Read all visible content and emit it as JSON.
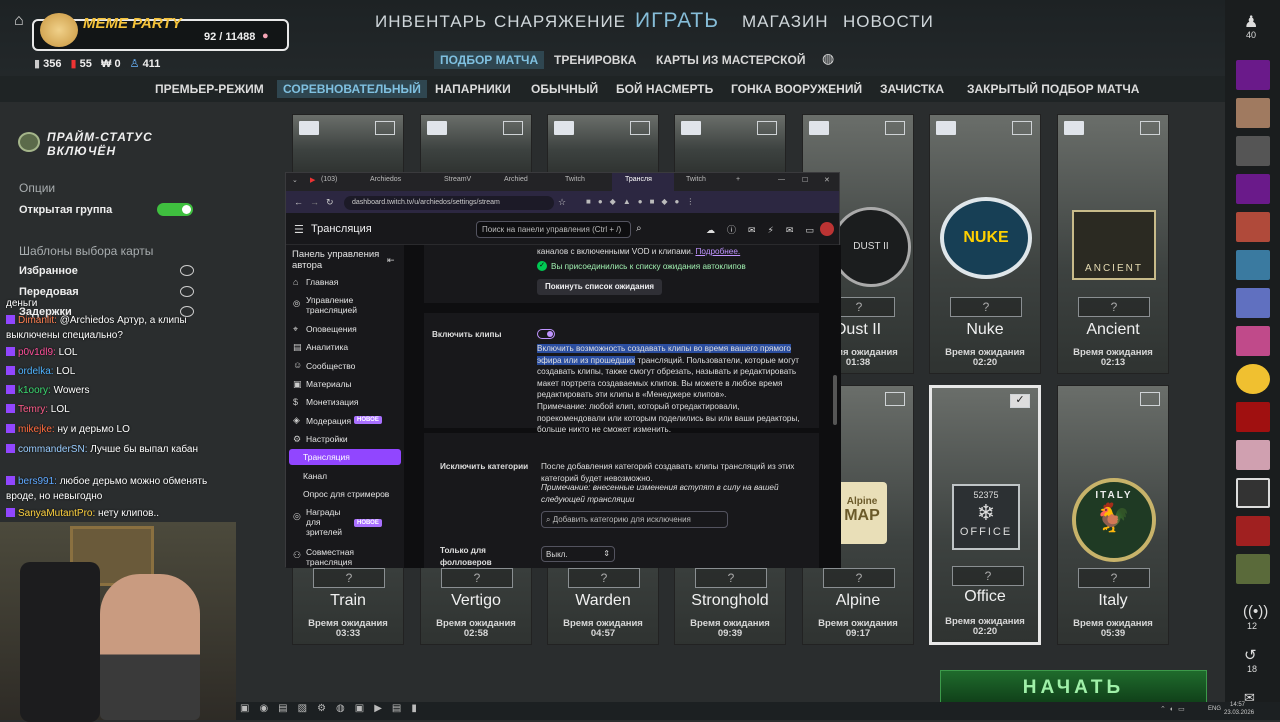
{
  "colors": {
    "accent": "#7fc0e0",
    "twitch": "#9146ff",
    "green": "#2ea043",
    "new_badge": "#a970ff"
  },
  "header": {
    "party_name": "MEME PARTY",
    "xp": "92 / 11488",
    "stats": [
      {
        "icon": "coin-icon",
        "value": "356"
      },
      {
        "icon": "medal-icon",
        "value": "55"
      },
      {
        "icon": "key-icon",
        "value": "0"
      },
      {
        "icon": "people-icon",
        "value": "411"
      }
    ],
    "nav": [
      "ИНВЕНТАРЬ",
      "СНАРЯЖЕНИЕ",
      "ИГРАТЬ",
      "МАГАЗИН",
      "НОВОСТИ"
    ],
    "subnav": [
      "ПОДБОР МАТЧА",
      "ТРЕНИРОВКА",
      "КАРТЫ ИЗ МАСТЕРСКОЙ"
    ],
    "modes": [
      "ПРЕМЬЕР-РЕЖИМ",
      "СОРЕВНОВАТЕЛЬНЫЙ",
      "НАПАРНИКИ",
      "ОБЫЧНЫЙ",
      "БОЙ НАСМЕРТЬ",
      "ГОНКА ВООРУЖЕНИЙ",
      "ЗАЧИСТКА",
      "ЗАКРЫТЫЙ ПОДБОР МАТЧА"
    ]
  },
  "left": {
    "prime_line1": "ПРАЙМ-СТАТУС",
    "prime_line2": "ВКЛЮЧЁН",
    "options": "Опции",
    "open_group": "Открытая группа",
    "templates": "Шаблоны выбора карты",
    "t1": "Избранное",
    "t2": "Передовая",
    "t3": "Задержки"
  },
  "maps_top": [
    {
      "name": "Dust II",
      "label": "Время ожидания",
      "time": "01:38"
    },
    {
      "name": "Nuke",
      "label": "Время ожидания",
      "time": "02:20"
    },
    {
      "name": "Ancient",
      "label": "Время ожидания",
      "time": "02:13"
    }
  ],
  "emblems": {
    "dust": "DUST II",
    "nuke": "NUKE",
    "ancient": "ANCIENT",
    "alpine": "Alpine",
    "alpine2": "MAP",
    "office": "52375",
    "office2": "OFFICE",
    "italy": "ITALY"
  },
  "maps_bottom": [
    {
      "name": "Train",
      "label": "Время ожидания",
      "time": "03:33"
    },
    {
      "name": "Vertigo",
      "label": "Время ожидания",
      "time": "02:58"
    },
    {
      "name": "Warden",
      "label": "Время ожидания",
      "time": "04:57"
    },
    {
      "name": "Stronghold",
      "label": "Время ожидания",
      "time": "09:39"
    },
    {
      "name": "Alpine",
      "label": "Время ожидания",
      "time": "09:17"
    },
    {
      "name": "Office",
      "label": "Время ожидания",
      "time": "02:20"
    },
    {
      "name": "Italy",
      "label": "Время ожидания",
      "time": "05:39"
    }
  ],
  "q": "?",
  "start": "НАЧАТЬ",
  "rightbar": {
    "friends": "40",
    "live": "12",
    "recent": "18"
  },
  "browser": {
    "tabs": [
      "(103)",
      "Archiedos",
      "StreamV",
      "Archied",
      "Twitch",
      "Трансля",
      "Twitch"
    ],
    "url": "dashboard.twitch.tv/u/archiedos/settings/stream",
    "app_title": "Трансляция",
    "search": "Поиск на панели управления (Ctrl + /)",
    "sidebar_title": "Панель управления автора",
    "sidebar": [
      "Главная",
      "Управление трансляцией",
      "Оповещения",
      "Аналитика",
      "Сообщество",
      "Материалы",
      "Монетизация",
      "Модерация",
      "Настройки",
      "Трансляция",
      "Канал",
      "Опрос для стримеров",
      "Награды для зрителей",
      "Совместная трансляция"
    ],
    "new": "НОВОЕ",
    "top_text": "каналов с включенными VOD и клипами.",
    "more": "Подробнее.",
    "joined": "Вы присоединились к списку ожидания автоклипов",
    "leave_btn": "Покинуть список ожидания",
    "clips_label": "Включить клипы",
    "clips_hl": "Включить возможность создавать клипы во время вашего прямого эфира или из прошедших",
    "clips_body": "трансляций. Пользователи, которые могут создавать клипы, также смогут обрезать, называть и редактировать макет портрета создаваемых клипов. Вы можете в любое время редактировать эти клипы в «Менеджере клипов».",
    "clips_note": "Примечание: любой клип, который отредактировали, порекомендовали или которым поделились вы или ваши редакторы, больше никто не сможет изменить.",
    "excl_label": "Исключить категории",
    "excl_body": "После добавления категорий создавать клипы трансляций из этих категорий будет невозможно.",
    "excl_note": "Примечание: внесенные изменения вступят в силу на вашей следующей трансляции",
    "excl_input": "Добавить категорию для исключения",
    "foll_label": "Только для фолловеров",
    "foll_value": "Выкл."
  },
  "chat": [
    {
      "user": "",
      "text": "деньги",
      "color": "#ffffff"
    },
    {
      "user": "Dimanlit:",
      "text": "@Archiedos Артур, а клипы выключены специально?",
      "color": "#ff7f50"
    },
    {
      "user": "p0v1dl9:",
      "text": "LOL",
      "color": "#ff4f9a"
    },
    {
      "user": "ordelka:",
      "text": "LOL",
      "color": "#4fb3ff"
    },
    {
      "user": "k1oory:",
      "text": "Wowers",
      "color": "#3ad96f"
    },
    {
      "user": "Temry:",
      "text": "LOL",
      "color": "#ff5c8a"
    },
    {
      "user": "mikejke:",
      "text": "ну и дерьмо LO",
      "color": "#ff6a3d"
    },
    {
      "user": "commanderSN:",
      "text": "Лучше бы выпал кабан",
      "color": "#9acdff"
    },
    {
      "user": "bers991:",
      "text": "любое дерьмо можно обменять вроде, но невыгодно",
      "color": "#5fa8ff"
    },
    {
      "user": "SanyaMutantPro:",
      "text": "нету клипов..",
      "color": "#ffd23f"
    }
  ],
  "clock": {
    "lang": "ENG",
    "time": "14:57",
    "date": "23.03.2026"
  }
}
